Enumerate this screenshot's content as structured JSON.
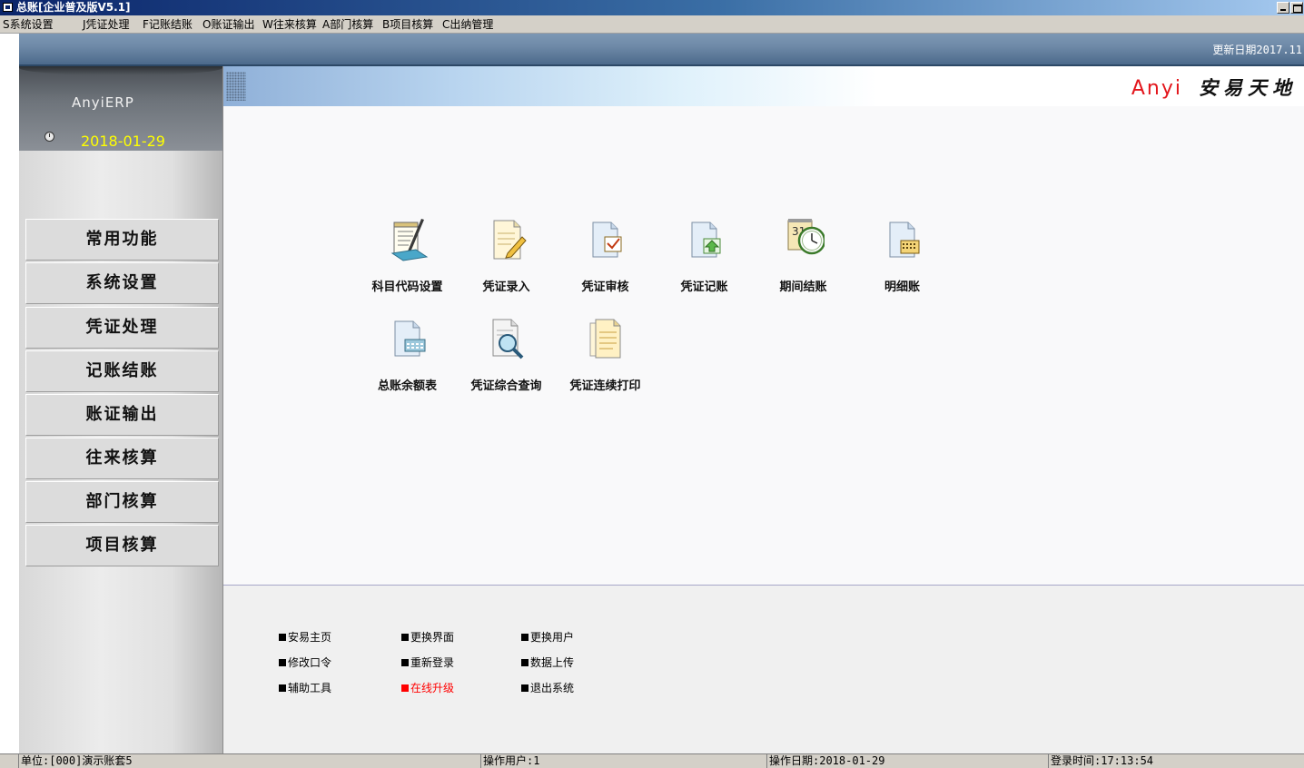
{
  "window": {
    "title": "总账[企业普及版V5.1]"
  },
  "menu": [
    "S系统设置",
    "J凭证处理",
    "F记账结账",
    "O账证输出",
    "W往来核算",
    "A部门核算",
    "B项目核算",
    "C出纳管理"
  ],
  "header": {
    "update_date": "更新日期2017.11"
  },
  "sidebar": {
    "logo": "AnyiERP",
    "date": "2018-01-29",
    "nav": [
      "常用功能",
      "系统设置",
      "凭证处理",
      "记账结账",
      "账证输出",
      "往来核算",
      "部门核算",
      "项目核算"
    ]
  },
  "brand": {
    "en": "Anyi",
    "cn": "安易天地"
  },
  "functions": [
    {
      "label": "科目代码设置",
      "icon": "pen-document-icon"
    },
    {
      "label": "凭证录入",
      "icon": "voucher-edit-icon"
    },
    {
      "label": "凭证审核",
      "icon": "voucher-check-icon"
    },
    {
      "label": "凭证记账",
      "icon": "voucher-post-icon"
    },
    {
      "label": "期间结账",
      "icon": "calendar-clock-icon"
    },
    {
      "label": "明细账",
      "icon": "ledger-detail-icon"
    },
    {
      "label": "总账余额表",
      "icon": "balance-sheet-icon"
    },
    {
      "label": "凭证综合查询",
      "icon": "voucher-search-icon"
    },
    {
      "label": "凭证连续打印",
      "icon": "voucher-print-icon"
    }
  ],
  "footer_links": [
    {
      "label": "安易主页"
    },
    {
      "label": "更换界面"
    },
    {
      "label": "更换用户"
    },
    {
      "label": "修改口令"
    },
    {
      "label": "重新登录"
    },
    {
      "label": "数据上传"
    },
    {
      "label": "辅助工具"
    },
    {
      "label": "在线升级",
      "color": "#ff0000"
    },
    {
      "label": "退出系统"
    }
  ],
  "status": {
    "unit": "单位:[000]演示账套5",
    "user": "操作用户:1",
    "date": "操作日期:2018-01-29",
    "login": "登录时间:17:13:54"
  }
}
